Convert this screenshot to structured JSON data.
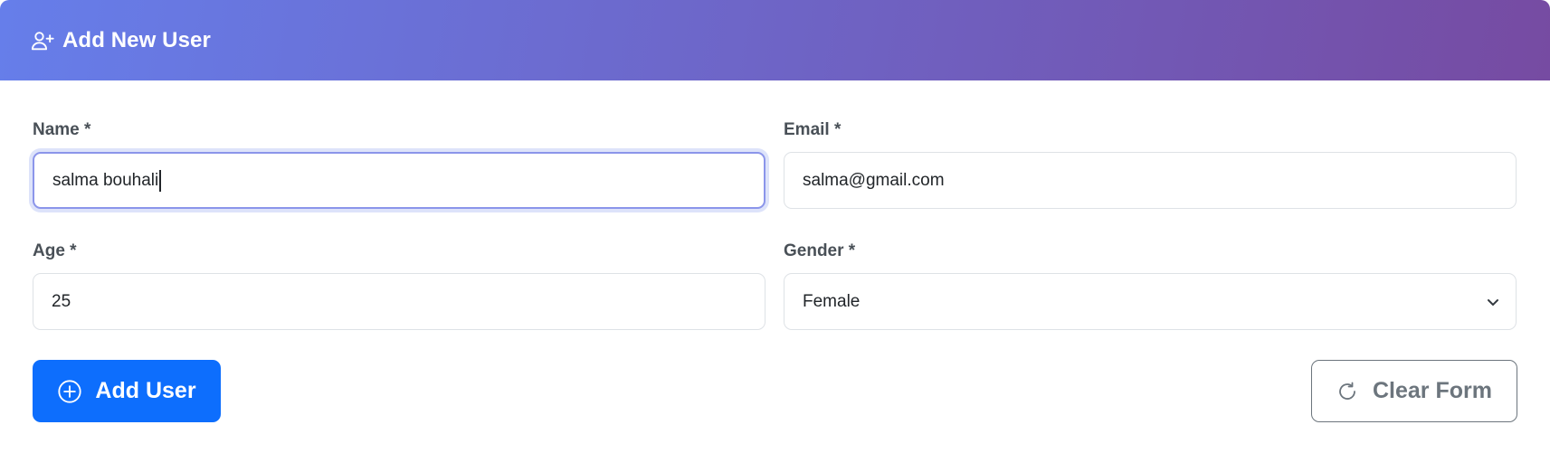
{
  "header": {
    "title": "Add New User",
    "icon": "user-plus-icon",
    "gradient_start": "#667eea",
    "gradient_end": "#764ba2"
  },
  "form": {
    "name": {
      "label": "Name *",
      "value": "salma bouhali"
    },
    "email": {
      "label": "Email *",
      "value": "salma@gmail.com"
    },
    "age": {
      "label": "Age *",
      "value": "25"
    },
    "gender": {
      "label": "Gender *",
      "selected": "Female"
    }
  },
  "actions": {
    "add_label": "Add User",
    "add_icon": "plus-circle-icon",
    "add_color": "#0d6efd",
    "clear_label": "Clear Form",
    "clear_icon": "refresh-icon",
    "clear_color": "#6c757d"
  }
}
